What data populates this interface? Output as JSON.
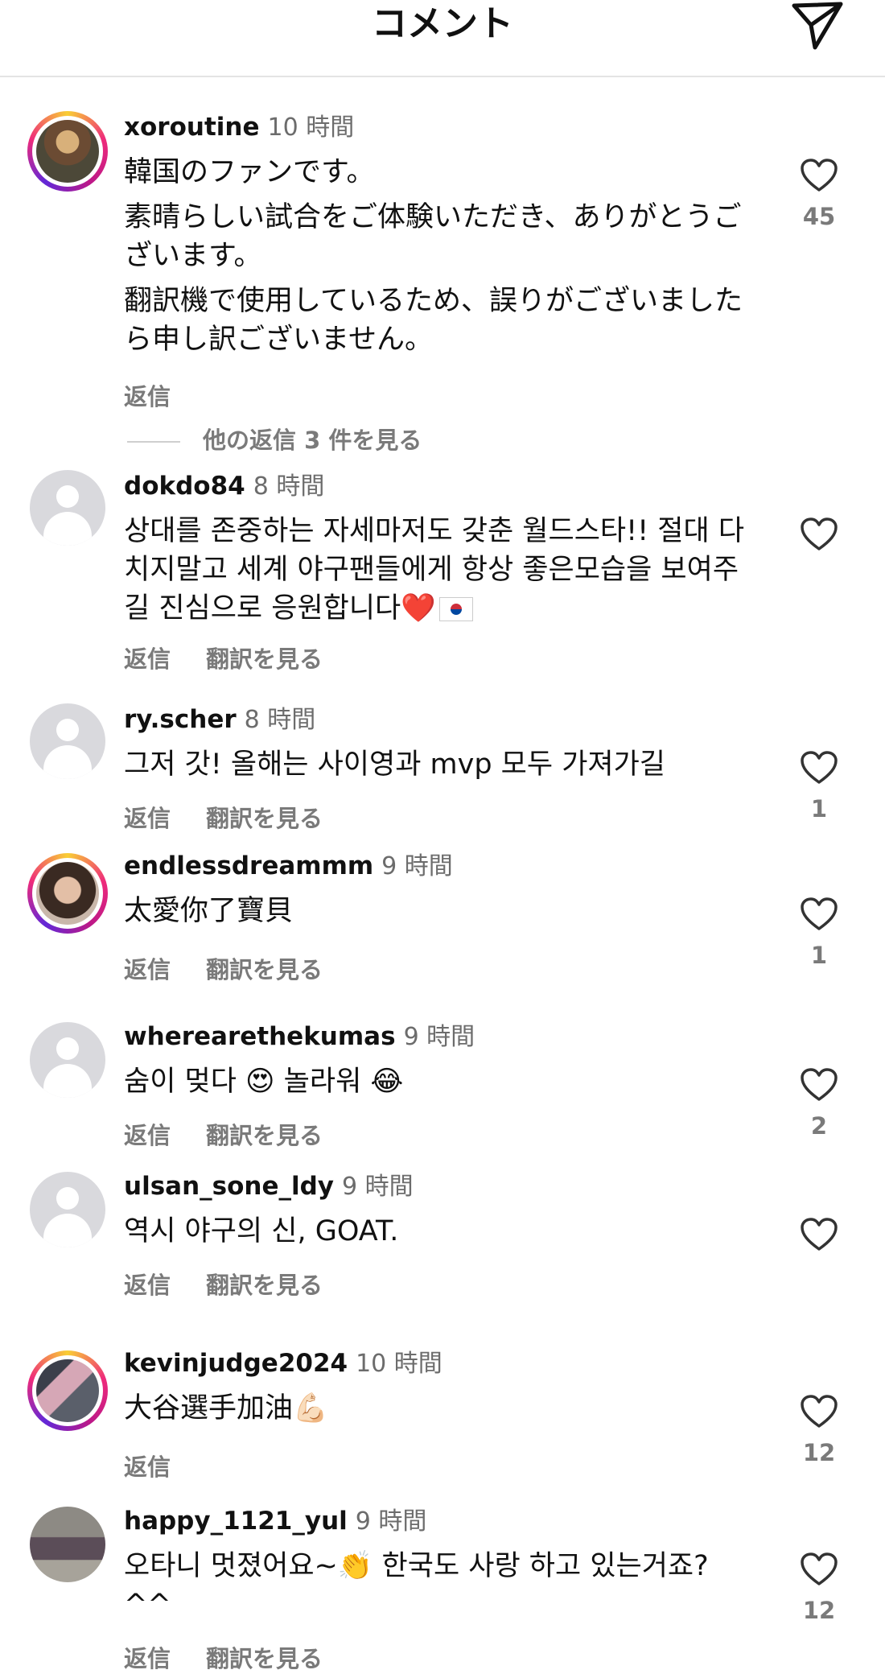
{
  "header": {
    "title": "コメント",
    "share_icon": "paper-plane-icon"
  },
  "labels": {
    "reply": "返信",
    "translate": "翻訳を見る"
  },
  "comments": [
    {
      "username": "xoroutine",
      "time": "10 時間",
      "avatar": "photo",
      "paragraphs": [
        "韓国のファンです。",
        "素晴らしい試合をご体験いただき、ありがとうございます。",
        "翻訳機で使用しているため、誤りがございましたら申し訳ございません。"
      ],
      "likes": "45",
      "more_replies": "他の返信 3 件を見る"
    },
    {
      "username": "dokdo84",
      "time": "8 時間",
      "avatar": "default",
      "text": "상대를 존중하는 자세마저도 갖춘 월드스타!! 절대 다치지말고 세계 야구팬들에게 항상 좋은모습을 보여주길 진심으로 응원합니다",
      "emoji": "❤️",
      "likes": ""
    },
    {
      "username": "ry.scher",
      "time": "8 時間",
      "avatar": "default",
      "text": "그저 갓! 올해는 사이영과 mvp 모두 가져가길",
      "likes": "1"
    },
    {
      "username": "endlessdreammm",
      "time": "9 時間",
      "avatar": "photo",
      "text": "太愛你了寶貝",
      "likes": "1"
    },
    {
      "username": "wherearethekumas",
      "time": "9 時間",
      "avatar": "default",
      "text": "숨이 멎다 😍 놀라워 😂",
      "likes": "2"
    },
    {
      "username": "ulsan_sone_ldy",
      "time": "9 時間",
      "avatar": "default",
      "text": "역시 야구의 신, GOAT.",
      "likes": ""
    },
    {
      "username": "kevinjudge2024",
      "time": "10 時間",
      "avatar": "photo",
      "text": "大谷選手加油💪🏻",
      "likes": "12"
    },
    {
      "username": "happy_1121_yul",
      "time": "9 時間",
      "avatar": "photo",
      "text": "오타니 멋졌어요~👏 한국도 사랑 하고 있는거죠?^^",
      "likes": "12"
    }
  ],
  "colors": {
    "secondary_text": "#7a7a7a",
    "divider": "#e4e4e4",
    "avatar_placeholder": "#d9d9dd"
  }
}
